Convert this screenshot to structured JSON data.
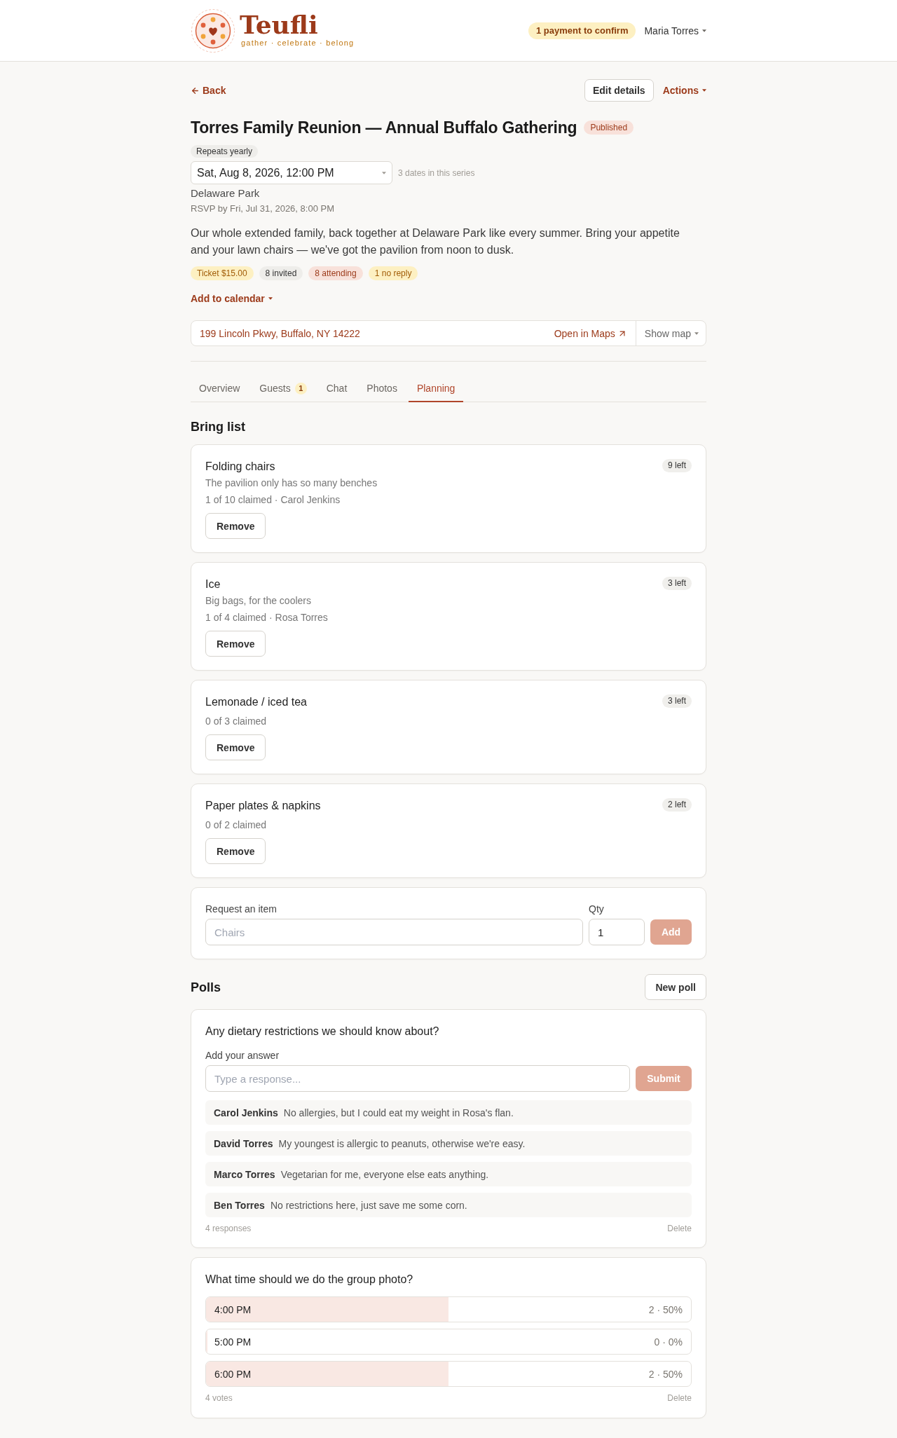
{
  "header": {
    "brand": "Teufli",
    "tagline": "gather · celebrate · belong",
    "payment_notice": "1 payment to confirm",
    "user_menu": "Maria Torres"
  },
  "toolbar": {
    "back": "Back",
    "edit_button": "Edit details",
    "actions_menu": "Actions"
  },
  "event": {
    "title": "Torres Family Reunion — Annual Buffalo Gathering",
    "status": "Published",
    "recurrence": "Repeats yearly",
    "date_select": {
      "value": "Sat, Aug 8, 2026, 12:00 PM"
    },
    "series_note": "3 dates in this series",
    "venue": "Delaware Park",
    "rsvp_deadline": "RSVP by Fri, Jul 31, 2026, 8:00 PM",
    "description": "Our whole extended family, back together at Delaware Park like every summer. Bring your appetite and your lawn chairs — we've got the pavilion from noon to dusk.",
    "chips": [
      {
        "label": "Ticket $15.00",
        "kind": "ticket"
      },
      {
        "label": "8 invited",
        "kind": "neutral"
      },
      {
        "label": "8 attending",
        "kind": "attending"
      },
      {
        "label": "1 no reply",
        "kind": "pending"
      }
    ],
    "calendar_menu": "Add to calendar"
  },
  "location": {
    "address": "199 Lincoln Pkwy, Buffalo, NY 14222",
    "open_maps": "Open in Maps",
    "show_map": "Show map"
  },
  "tabs": [
    {
      "label": "Overview",
      "selected": false
    },
    {
      "label": "Guests",
      "badge": "1",
      "selected": false
    },
    {
      "label": "Chat",
      "selected": false
    },
    {
      "label": "Photos",
      "selected": false
    },
    {
      "label": "Planning",
      "selected": true
    }
  ],
  "bring_list": {
    "title": "Bring list",
    "items": [
      {
        "name": "Folding chairs",
        "note": "The pavilion only has so many benches",
        "claimed": "1 of 10 claimed · Carol Jenkins",
        "remaining": "9 left",
        "button": "Remove"
      },
      {
        "name": "Ice",
        "note": "Big bags, for the coolers",
        "claimed": "1 of 4 claimed · Rosa Torres",
        "remaining": "3 left",
        "button": "Remove"
      },
      {
        "name": "Lemonade / iced tea",
        "claimed": "0 of 3 claimed",
        "remaining": "3 left",
        "button": "Remove"
      },
      {
        "name": "Paper plates & napkins",
        "claimed": "0 of 2 claimed",
        "remaining": "2 left",
        "button": "Remove"
      }
    ],
    "request_form": {
      "item_label": "Request an item",
      "item_placeholder": "Chairs",
      "qty_label": "Qty",
      "qty_value": "1",
      "add_button": {
        "label": "Add",
        "disabled": true
      }
    }
  },
  "polls": {
    "title": "Polls",
    "new_button": "New poll",
    "items": [
      {
        "kind": "text",
        "question": "Any dietary restrictions we should know about?",
        "answer_label": "Add your answer",
        "placeholder": "Type a response...",
        "submit_button": {
          "label": "Submit",
          "disabled": true
        },
        "responses": [
          {
            "name": "Carol Jenkins",
            "text": "No allergies, but I could eat my weight in Rosa's flan."
          },
          {
            "name": "David Torres",
            "text": "My youngest is allergic to peanuts, otherwise we're easy."
          },
          {
            "name": "Marco Torres",
            "text": "Vegetarian for me, everyone else eats anything."
          },
          {
            "name": "Ben Torres",
            "text": "No restrictions here, just save me some corn."
          }
        ],
        "summary": "4 responses",
        "delete": "Delete"
      },
      {
        "kind": "choice",
        "question": "What time should we do the group photo?",
        "options": [
          {
            "label": "4:00 PM",
            "result": "2 · 50%",
            "level": 0.5
          },
          {
            "label": "5:00 PM",
            "result": "0 · 0%",
            "level": 0
          },
          {
            "label": "6:00 PM",
            "result": "2 · 50%",
            "level": 0.5
          }
        ],
        "summary": "4 votes",
        "delete": "Delete"
      }
    ]
  }
}
